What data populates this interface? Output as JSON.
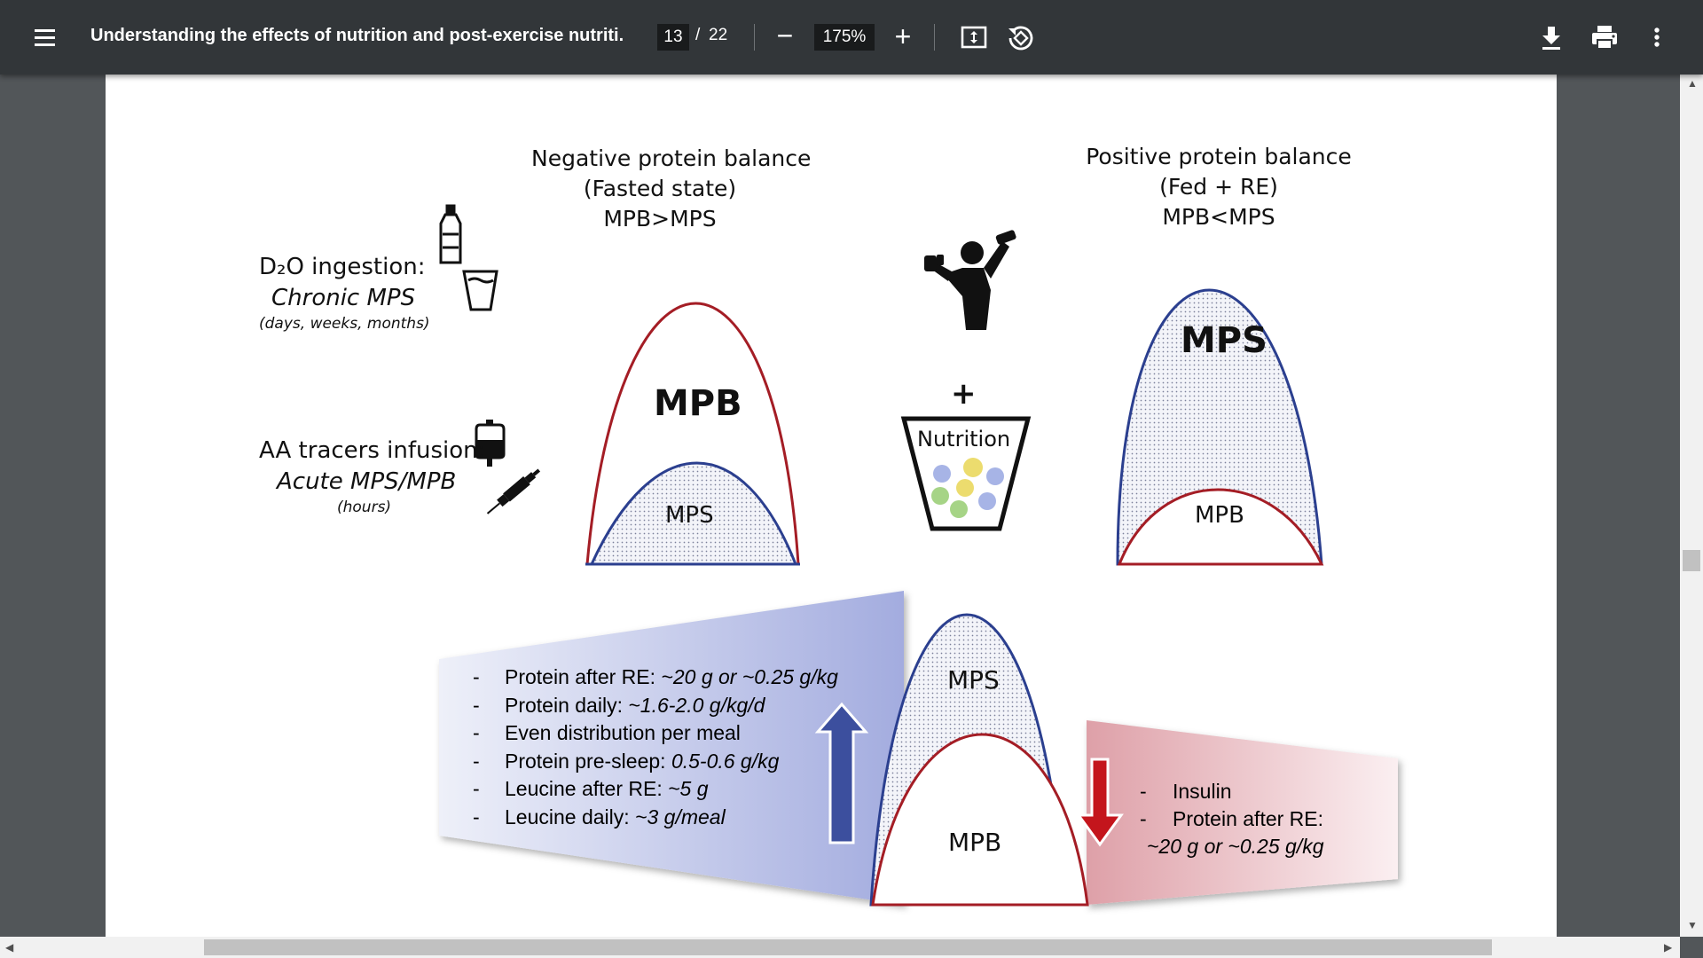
{
  "viewer": {
    "title": "Understanding the effects of nutrition and post-exercise nutriti...",
    "page_current": "13",
    "page_separator": "/",
    "page_total": "22",
    "zoom": "175%",
    "zoom_out_symbol": "−",
    "zoom_in_symbol": "+"
  },
  "figure": {
    "negative_heading": [
      "Negative protein balance",
      "(Fasted state)",
      "MPB>MPS"
    ],
    "positive_heading": [
      "Positive protein balance",
      "(Fed + RE)",
      "MPB<MPS"
    ],
    "d2o_title": "D₂O ingestion:",
    "d2o_sub": "Chronic MPS",
    "d2o_note": "(days, weeks, months)",
    "aa_title": "AA tracers infusion:",
    "aa_sub": "Acute MPS/MPB",
    "aa_note": "(hours)",
    "neg_big_label": "MPB",
    "neg_small_label": "MPS",
    "pos_big_label": "MPS",
    "pos_small_label": "MPB",
    "plus_sign": "+",
    "nutrition_label": "Nutrition",
    "bottom_big_label": "MPS",
    "bottom_small_label": "MPB",
    "dash": "-",
    "left_list": [
      {
        "text": "Protein after RE: ",
        "value": "~20 g or ~0.25 g/kg"
      },
      {
        "text": "Protein daily: ",
        "value": "~1.6-2.0 g/kg/d"
      },
      {
        "text": "Even distribution per meal",
        "value": ""
      },
      {
        "text": "Protein pre-sleep: ",
        "value": "0.5-0.6 g/kg"
      },
      {
        "text": "Leucine after RE: ",
        "value": "~5 g"
      },
      {
        "text": "Leucine daily:  ",
        "value": "~3 g/meal"
      }
    ],
    "right_list": [
      "Insulin",
      "Protein after RE:"
    ],
    "right_value": "~20 g or ~0.25 g/kg",
    "colors": {
      "red": "#b0222a",
      "blue": "#2b3f8f",
      "arrow_blue": "#3c4f9e",
      "arrow_red": "#c4151c"
    }
  }
}
